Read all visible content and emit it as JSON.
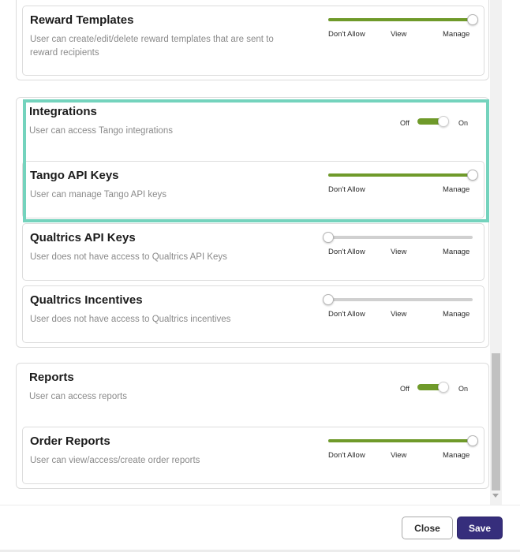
{
  "colors": {
    "accent_green": "#6f9a2a",
    "highlight": "#74d3bd",
    "save_bg": "#362e7c"
  },
  "sections": {
    "rewards": {
      "reward_templates": {
        "title": "Reward Templates",
        "description": "User can create/edit/delete reward templates that are sent to reward recipients",
        "level": 1.0,
        "labels": [
          "Don't Allow",
          "View",
          "Manage"
        ]
      }
    },
    "integrations": {
      "title": "Integrations",
      "description": "User can access Tango integrations",
      "toggle": {
        "off": "Off",
        "on": "On",
        "state": "on"
      },
      "tango_api_keys": {
        "title": "Tango API Keys",
        "description": "User can manage Tango API keys",
        "level": 1.0,
        "labels": [
          "Don't Allow",
          "Manage"
        ]
      },
      "qualtrics_api_keys": {
        "title": "Qualtrics API Keys",
        "description": "User does not have access to Qualtrics API Keys",
        "level": 0.0,
        "labels": [
          "Don't Allow",
          "View",
          "Manage"
        ]
      },
      "qualtrics_incentives": {
        "title": "Qualtrics Incentives",
        "description": "User does not have access to Qualtrics incentives",
        "level": 0.0,
        "labels": [
          "Don't Allow",
          "View",
          "Manage"
        ]
      }
    },
    "reports": {
      "title": "Reports",
      "description": "User can access reports",
      "toggle": {
        "off": "Off",
        "on": "On",
        "state": "on"
      },
      "order_reports": {
        "title": "Order Reports",
        "description": "User can view/access/create order reports",
        "level": 1.0,
        "labels": [
          "Don't Allow",
          "View",
          "Manage"
        ]
      }
    }
  },
  "footer": {
    "close_label": "Close",
    "save_label": "Save"
  }
}
